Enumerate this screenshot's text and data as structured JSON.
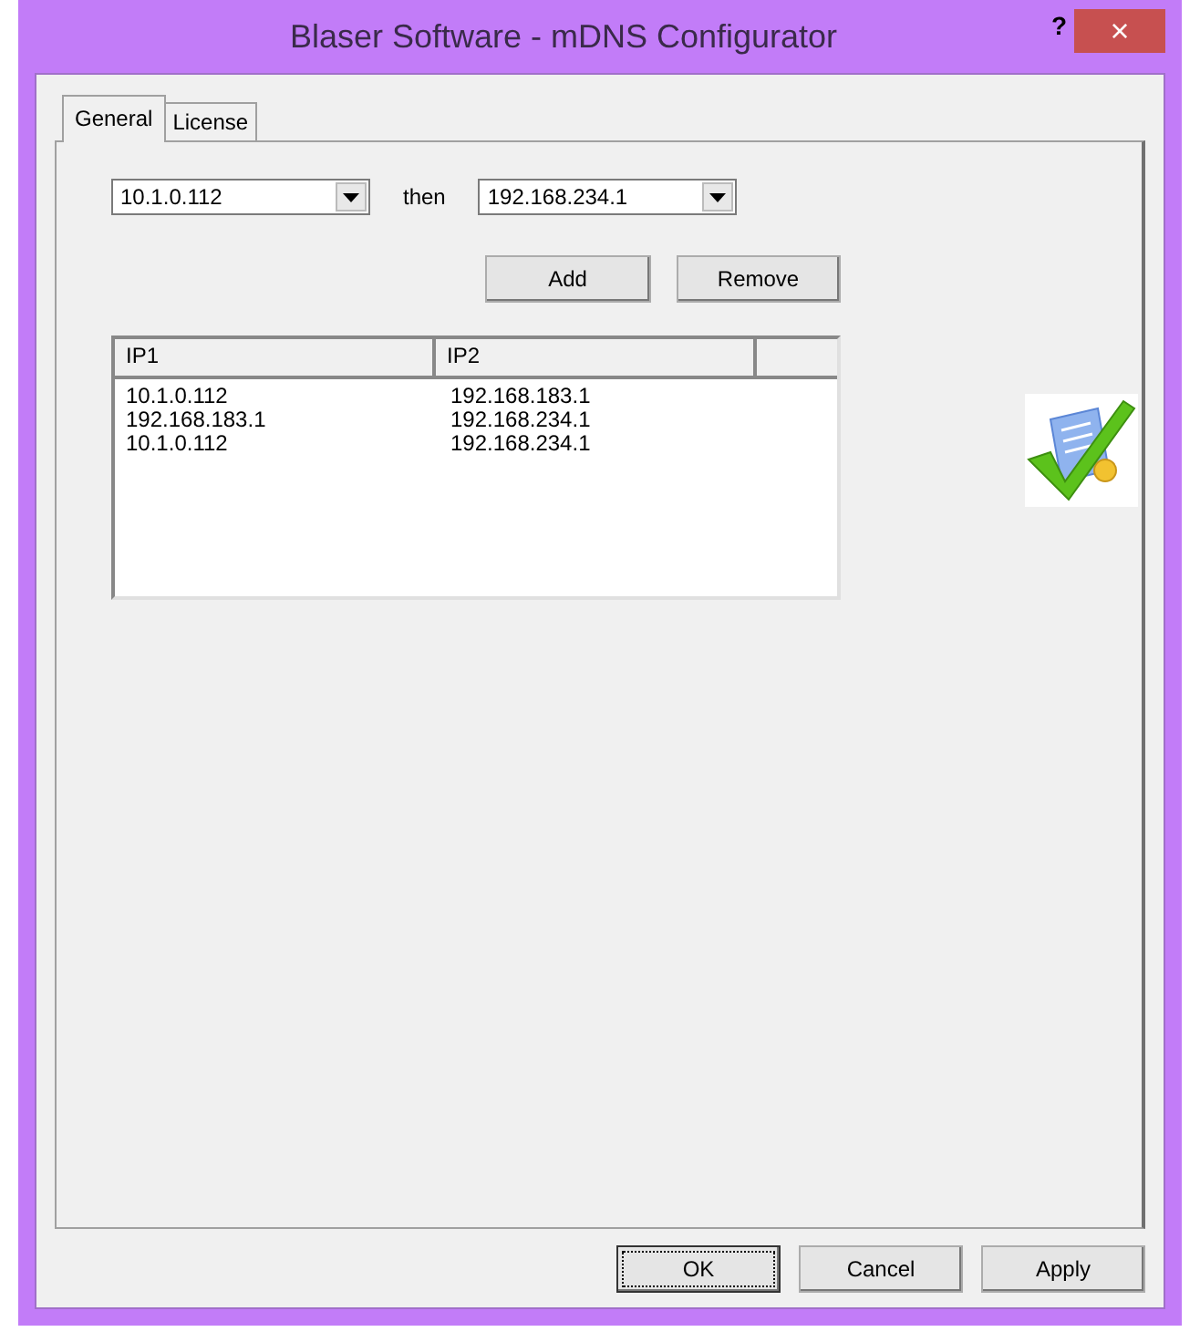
{
  "window": {
    "title": "Blaser Software - mDNS Configurator",
    "help": "?",
    "close": "×"
  },
  "tabs": [
    {
      "label": "General",
      "selected": true
    },
    {
      "label": "License",
      "selected": false
    }
  ],
  "rule": {
    "ip1": "10.1.0.112",
    "connector": "then",
    "ip2": "192.168.234.1"
  },
  "actions": [
    "Add",
    "Remove"
  ],
  "table": {
    "columns": [
      "IP1",
      "IP2"
    ],
    "rows": [
      [
        "10.1.0.112",
        "192.168.183.1"
      ],
      [
        "192.168.183.1",
        "192.168.234.1"
      ],
      [
        "10.1.0.112",
        "192.168.234.1"
      ]
    ]
  },
  "buttons": [
    {
      "label": "OK",
      "focused": true
    },
    {
      "label": "Cancel",
      "focused": false
    },
    {
      "label": "Apply",
      "focused": false
    }
  ]
}
